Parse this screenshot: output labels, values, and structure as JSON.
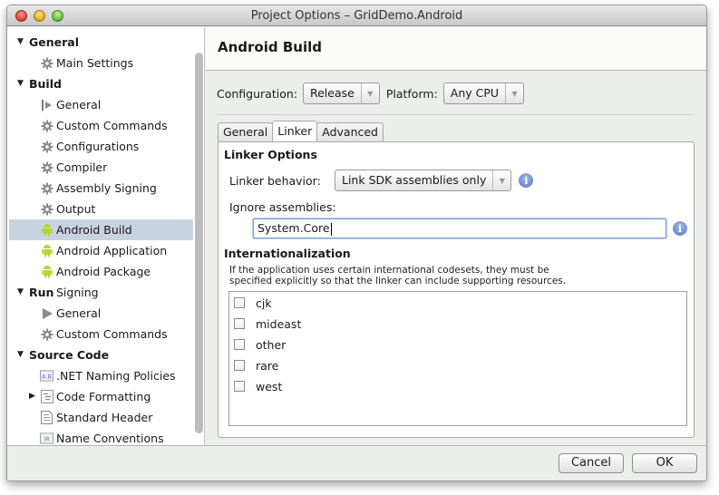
{
  "window": {
    "title": "Project Options – GridDemo.Android"
  },
  "sidebar": {
    "items": [
      {
        "type": "group",
        "label": "General"
      },
      {
        "type": "item",
        "label": "Main Settings",
        "icon": "gear-icon"
      },
      {
        "type": "group",
        "label": "Build"
      },
      {
        "type": "item",
        "label": "General",
        "icon": "build-general-icon"
      },
      {
        "type": "item",
        "label": "Custom Commands",
        "icon": "gear-icon"
      },
      {
        "type": "item",
        "label": "Configurations",
        "icon": "gear-icon"
      },
      {
        "type": "item",
        "label": "Compiler",
        "icon": "gear-icon"
      },
      {
        "type": "item",
        "label": "Assembly Signing",
        "icon": "gear-icon"
      },
      {
        "type": "item",
        "label": "Output",
        "icon": "gear-icon"
      },
      {
        "type": "item",
        "label": "Android Build",
        "icon": "android-icon",
        "selected": true
      },
      {
        "type": "item",
        "label": "Android Application",
        "icon": "android-icon"
      },
      {
        "type": "item",
        "label": "Android Package Signing",
        "icon": "android-icon"
      },
      {
        "type": "group",
        "label": "Run"
      },
      {
        "type": "item",
        "label": "General",
        "icon": "play-icon"
      },
      {
        "type": "item",
        "label": "Custom Commands",
        "icon": "gear-icon"
      },
      {
        "type": "group",
        "label": "Source Code"
      },
      {
        "type": "item",
        "label": ".NET Naming Policies",
        "icon": "naming-policies-icon"
      },
      {
        "type": "item",
        "label": "Code Formatting",
        "icon": "code-formatting-icon",
        "expandable": true
      },
      {
        "type": "item",
        "label": "Standard Header",
        "icon": "document-icon"
      },
      {
        "type": "item",
        "label": "Name Conventions",
        "icon": "name-conventions-icon"
      }
    ]
  },
  "main": {
    "title": "Android Build",
    "configuration_label": "Configuration:",
    "configuration_value": "Release",
    "platform_label": "Platform:",
    "platform_value": "Any CPU",
    "tabs": [
      {
        "label": "General"
      },
      {
        "label": "Linker",
        "active": true
      },
      {
        "label": "Advanced"
      }
    ],
    "linker_options_title": "Linker Options",
    "linker_behavior_label": "Linker behavior:",
    "linker_behavior_value": "Link SDK assemblies only",
    "ignore_assemblies_label": "Ignore assemblies:",
    "ignore_assemblies_value": "System.Core",
    "internationalization_title": "Internationalization",
    "internationalization_desc_line1": "If the application uses certain international codesets, they must be",
    "internationalization_desc_line2": "specified explicitly so that the linker can include supporting resources.",
    "codesets": [
      {
        "label": "cjk",
        "checked": false
      },
      {
        "label": "mideast",
        "checked": false
      },
      {
        "label": "other",
        "checked": false
      },
      {
        "label": "rare",
        "checked": false
      },
      {
        "label": "west",
        "checked": false
      }
    ]
  },
  "footer": {
    "cancel_label": "Cancel",
    "ok_label": "OK"
  },
  "colors": {
    "selection": "#c9d3e0",
    "info_icon": "#6a86c8",
    "android_green": "#a4c639"
  }
}
